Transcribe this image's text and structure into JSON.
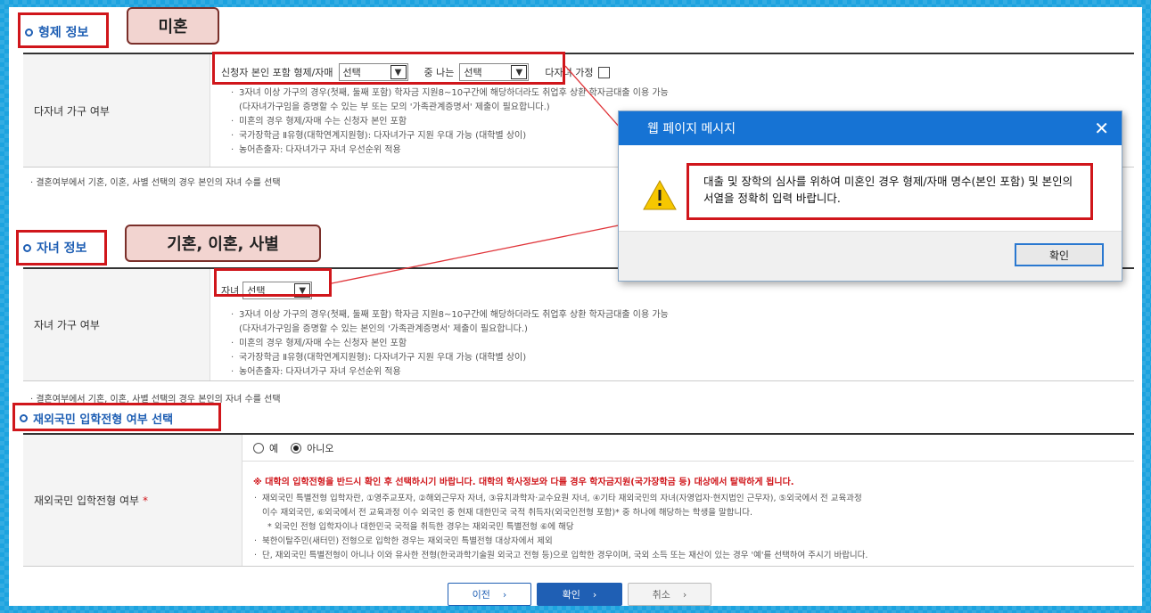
{
  "sibling_section": {
    "title": "형제 정보",
    "callout": "미혼",
    "row_label": "다자녀 가구 여부",
    "select1_label": "신청자 본인 포함 형제/자매",
    "select1_value": "선택",
    "select2_label": "중 나는",
    "select2_value": "선택",
    "checkbox_label": "다자녀 가정",
    "notes": [
      "3자녀 이상 가구의 경우(첫째, 둘째 포함) 학자금 지원8~10구간에 해당하더라도 취업후 상환 학자금대출 이용 가능",
      "(다자녀가구임을 증명할 수 있는 부 또는 모의 '가족관계증명서' 제출이 필요합니다.)",
      "미혼의 경우 형제/자매 수는 신청자 본인 포함",
      "국가장학금 Ⅱ유형(대학연계지원형): 다자녀가구 지원 우대 가능 (대학별 상이)",
      "농어촌출자: 다자녀가구 자녀 우선순위 적용"
    ],
    "footnote": "결혼여부에서 기혼, 이혼, 사별 선택의 경우 본인의 자녀 수를 선택"
  },
  "children_section": {
    "title": "자녀 정보",
    "callout": "기혼, 이혼, 사별",
    "row_label": "자녀 가구 여부",
    "select_label": "자녀",
    "select_value": "선택",
    "notes": [
      "3자녀 이상 가구의 경우(첫째, 둘째 포함) 학자금 지원8~10구간에 해당하더라도 취업후 상환 학자금대출 이용 가능",
      "(다자녀가구임을 증명할 수 있는 본인의 '가족관계증명서' 제출이 필요합니다.)",
      "미혼의 경우 형제/자매 수는 신청자 본인 포함",
      "국가장학금 Ⅱ유형(대학연계지원형): 다자녀가구 지원 우대 가능 (대학별 상이)",
      "농어촌출자: 다자녀가구 자녀 우선순위 적용"
    ],
    "footnote": "결혼여부에서 기혼, 이혼, 사별 선택의 경우 본인의 자녀 수를 선택"
  },
  "overseas_section": {
    "title": "재외국민 입학전형 여부 선택",
    "row_label": "재외국민 입학전형 여부",
    "required_mark": "*",
    "radio_yes": "예",
    "radio_no": "아니오",
    "warning": "※ 대학의 입학전형을 반드시 확인 후 선택하시기 바랍니다. 대학의 학사정보와 다를 경우 학자금지원(국가장학금 등) 대상에서 탈락하게 됩니다.",
    "notes": [
      "재외국민 특별전형 입학자란, ①영주교포자, ②해외근무자 자녀, ③유치과학자·교수요원 자녀, ④기타 재외국민의 자녀(자영업자·현지법인 근무자), ⑤외국에서 전 교육과정",
      "이수 재외국민, ⑥외국에서 전 교육과정 이수 외국인 중 현재 대한민국 국적 취득자(외국인전형 포함)* 중 하나에 해당하는 학생을 말합니다.",
      "* 외국인 전형 입학자이나 대한민국 국적을 취득한 경우는 재외국민 특별전형 ⑥에 해당",
      "북한이탈주민(새터민) 전형으로 입학한 경우는 재외국민 특별전형 대상자에서 제외",
      "단, 재외국민 특별전형이 아니나 이와 유사한 전형(한국과학기술원 외국고 전형 등)으로 입학한 경우이며, 국외 소득 또는 재산이 있는 경우 '예'를 선택하여 주시기 바랍니다."
    ]
  },
  "dialog": {
    "title": "웹 페이지 메시지",
    "close": "✕",
    "message": "대출 및 장학의 심사를 위하여 미혼인 경우 형제/자매 명수(본인 포함) 및 본인의 서열을 정확히 입력 바랍니다.",
    "ok_label": "확인"
  },
  "nav": {
    "prev": "이전",
    "next": "확인",
    "cancel": "취소",
    "arrow": "›"
  }
}
